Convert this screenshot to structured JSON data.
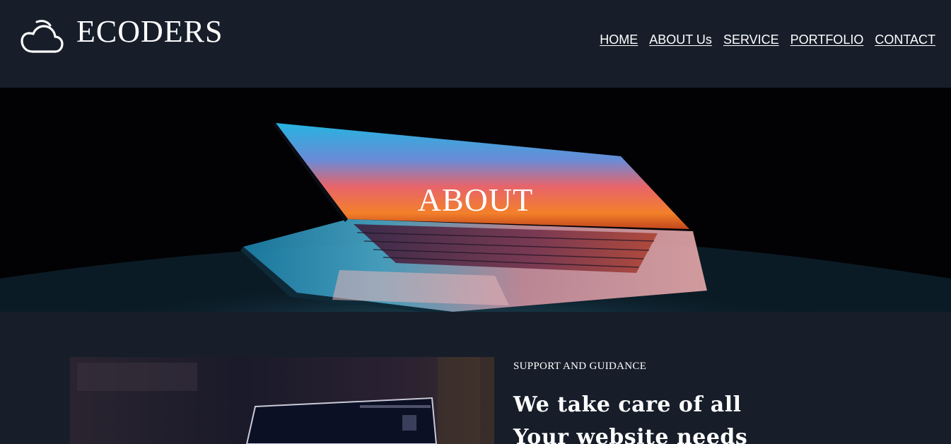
{
  "brand": {
    "name": "ECODERS",
    "logo_icon": "cloud-icon"
  },
  "nav": {
    "items": [
      {
        "label": "HOME"
      },
      {
        "label": "ABOUT Us"
      },
      {
        "label": "SERVICE"
      },
      {
        "label": "PORTFOLIO"
      },
      {
        "label": "CONTACT"
      }
    ]
  },
  "hero": {
    "title": "ABOUT"
  },
  "about": {
    "kicker": "SUPPORT AND GUIDANCE",
    "headline_line1": "We take care of all",
    "headline_line2": "Your website needs"
  },
  "colors": {
    "background": "#171e2a",
    "text": "#ffffff"
  }
}
